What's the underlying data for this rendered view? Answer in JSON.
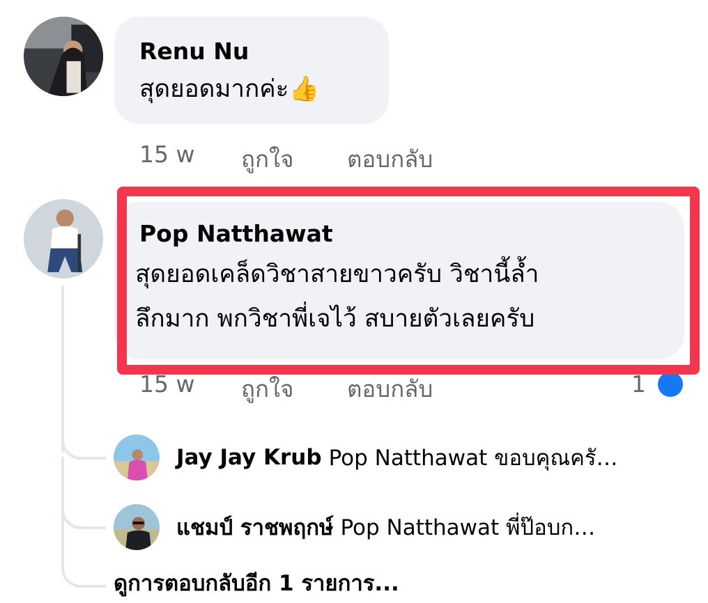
{
  "comments": [
    {
      "author": "Renu Nu",
      "text": "สุดยอดมากค่ะ👍",
      "time": "15 w",
      "like_label": "ถูกใจ",
      "reply_label": "ตอบกลับ"
    },
    {
      "author": "Pop Natthawat",
      "text_line1": "สุดยอดเคล็ดวิชาสายขาวครับ วิชานี้ล้ำ",
      "text_line2": "ลึกมาก พกวิชาพี่เจไว้ สบายตัวเลยครับ",
      "time": "15 w",
      "like_label": "ถูกใจ",
      "reply_label": "ตอบกลับ",
      "reaction_count": "1"
    }
  ],
  "replies": [
    {
      "author": "Jay Jay Krub",
      "text": "Pop Natthawat ขอบคุณครั…"
    },
    {
      "author": "แชมป์ ราชพฤกษ์",
      "text": "Pop Natthawat พี่ป๊อบก…"
    }
  ],
  "more_replies_label": "ดูการตอบกลับอีก 1 รายการ...",
  "colors": {
    "highlight": "#f2364d",
    "bubble": "#f0f2f5",
    "meta_text": "#65676b",
    "reaction": "#1877f2"
  }
}
